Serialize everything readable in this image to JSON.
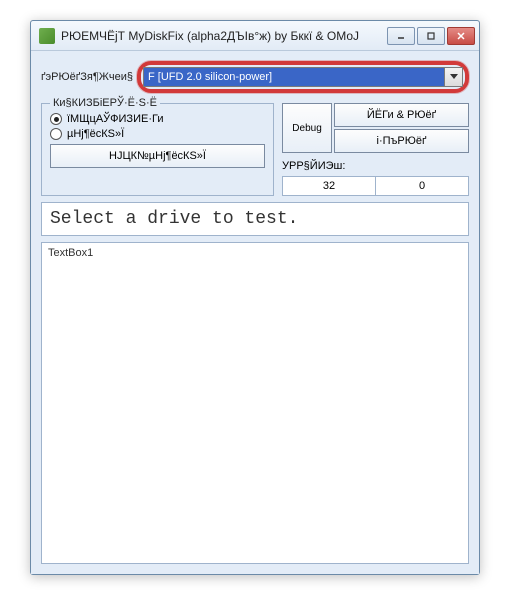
{
  "window": {
    "title": "РЮЕМЧЁјТ MyDiskFix (alpha2ДЪІв°ж) by Бккї & ОМоЈ"
  },
  "drive": {
    "label": "ґэРЮёґЗя¶Жчеи§",
    "selected": "F [UFD 2.0 silicon-power]"
  },
  "modeGroup": {
    "title": "Ки§КИЗБіЕРЎ·Ё·Ѕ·Ё",
    "option1": "їМЩцАЎФИЗИЕ·Ги",
    "option2": "µНј¶ёсКЅ»Ї",
    "button": "НЈЦК№µНј¶ёcКЅ»Ї"
  },
  "actions": {
    "debug": "Debug",
    "btn1": "ЙЁГи & РЮёґ",
    "btn2": "і·ПъРЮёґ"
  },
  "stats": {
    "label": "УРР§ЙИЭш:",
    "val1": "32",
    "val2": "0"
  },
  "status": "Select a drive to test.",
  "textbox": "TextBox1"
}
